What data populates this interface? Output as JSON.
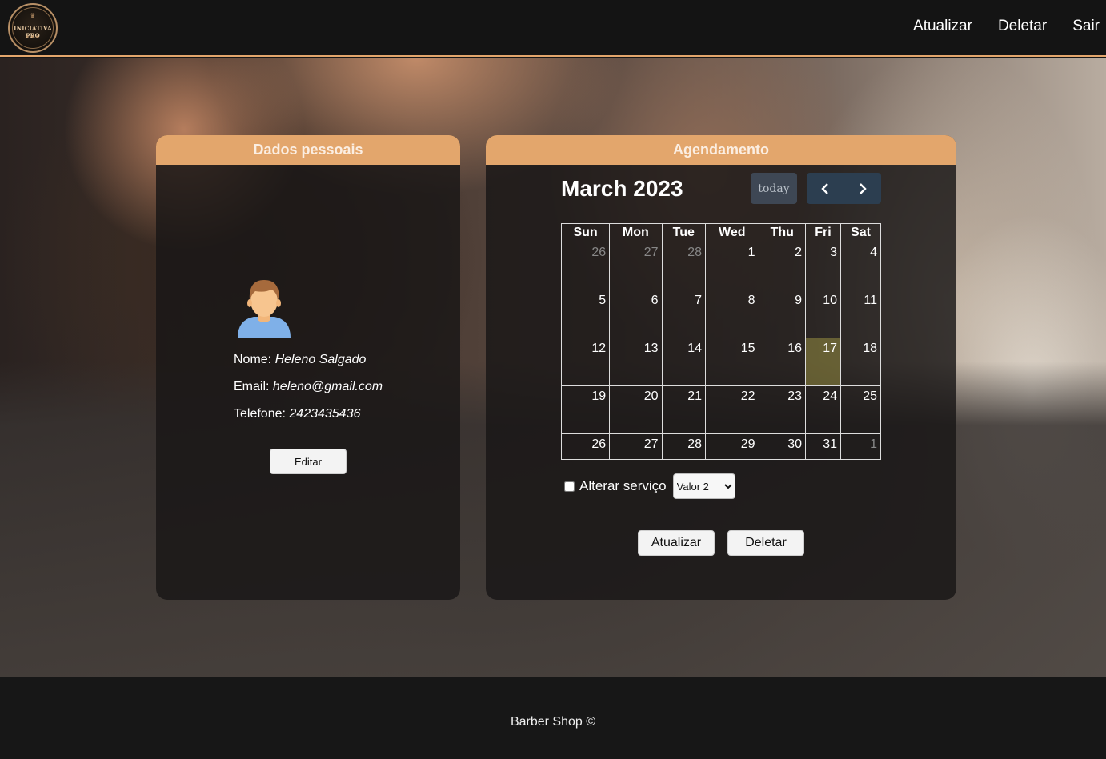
{
  "header": {
    "logo_text": "INICIATIVA PRO",
    "nav": [
      "Atualizar",
      "Deletar",
      "Sair"
    ]
  },
  "profile": {
    "title": "Dados pessoais",
    "name_label": "Nome:",
    "name": "Heleno Salgado",
    "email_label": "Email:",
    "email": "heleno@gmail.com",
    "phone_label": "Telefone:",
    "phone": "2423435436",
    "edit_label": "Editar"
  },
  "schedule": {
    "title": "Agendamento",
    "month_label": "March 2023",
    "today_label": "today",
    "weekdays": [
      "Sun",
      "Mon",
      "Tue",
      "Wed",
      "Thu",
      "Fri",
      "Sat"
    ],
    "weeks": [
      [
        "26",
        "27",
        "28",
        "1",
        "2",
        "3",
        "4"
      ],
      [
        "5",
        "6",
        "7",
        "8",
        "9",
        "10",
        "11"
      ],
      [
        "12",
        "13",
        "14",
        "15",
        "16",
        "17",
        "18"
      ],
      [
        "19",
        "20",
        "21",
        "22",
        "23",
        "24",
        "25"
      ],
      [
        "26",
        "27",
        "28",
        "29",
        "30",
        "31",
        "1"
      ]
    ],
    "service_label": "Alterar serviço",
    "service_value": "Valor 2",
    "update_label": "Atualizar",
    "delete_label": "Deletar"
  },
  "footer": {
    "text": "Barber Shop ©"
  },
  "colors": {
    "accent": "#e3a66c",
    "nav_button": "#2c3e50",
    "today_highlight": "#c8be50"
  }
}
